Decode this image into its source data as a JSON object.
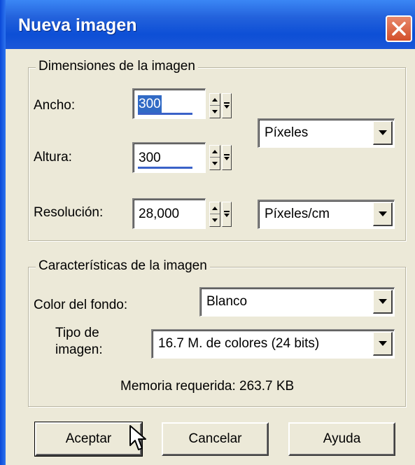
{
  "window": {
    "title": "Nueva imagen"
  },
  "dimensions": {
    "legend": "Dimensiones de la imagen",
    "width": {
      "label": "Ancho:",
      "value": "300"
    },
    "height": {
      "label": "Altura:",
      "value": "300"
    },
    "resolution": {
      "label": "Resolución:",
      "value": "28,000"
    },
    "size_unit": "Píxeles",
    "resolution_unit": "Píxeles/cm"
  },
  "characteristics": {
    "legend": "Características de la imagen",
    "background_color": {
      "label": "Color del fondo:",
      "value": "Blanco"
    },
    "image_type": {
      "label_line1": "Tipo de",
      "label_line2": "imagen:",
      "value": "16.7 M. de colores (24 bits)"
    },
    "memory": "Memoria requerida: 263.7 KB"
  },
  "buttons": {
    "ok": "Aceptar",
    "cancel": "Cancelar",
    "help": "Ayuda"
  },
  "colors": {
    "titlebar": "#0d4fd6",
    "close_button": "#d3502b",
    "selection": "#316ac5",
    "dialog_bg": "#ece9d8"
  }
}
